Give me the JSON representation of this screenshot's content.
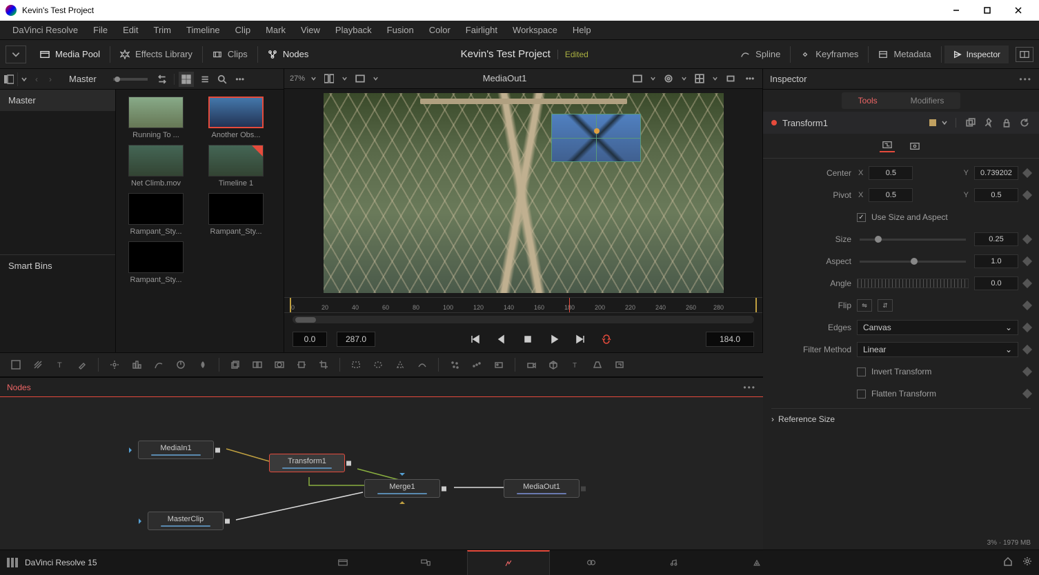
{
  "window": {
    "title": "Kevin's Test Project"
  },
  "menu": [
    "DaVinci Resolve",
    "File",
    "Edit",
    "Trim",
    "Timeline",
    "Clip",
    "Mark",
    "View",
    "Playback",
    "Fusion",
    "Color",
    "Fairlight",
    "Workspace",
    "Help"
  ],
  "uibar": {
    "media_pool": "Media Pool",
    "effects": "Effects Library",
    "clips": "Clips",
    "nodes": "Nodes",
    "project": "Kevin's Test Project",
    "edited": "Edited",
    "spline": "Spline",
    "keyframes": "Keyframes",
    "metadata": "Metadata",
    "inspector": "Inspector"
  },
  "mediapool": {
    "master": "Master",
    "tree_master": "Master",
    "smart_bins": "Smart Bins",
    "thumbs": [
      {
        "label": "Running To ..."
      },
      {
        "label": "Another Obs..."
      },
      {
        "label": "Net Climb.mov"
      },
      {
        "label": "Timeline 1"
      },
      {
        "label": "Rampant_Sty..."
      },
      {
        "label": "Rampant_Sty..."
      },
      {
        "label": "Rampant_Sty..."
      }
    ]
  },
  "viewer": {
    "zoom": "27%",
    "title": "MediaOut1",
    "ruler": [
      "0",
      "20",
      "40",
      "60",
      "80",
      "100",
      "120",
      "140",
      "160",
      "180",
      "200",
      "220",
      "240",
      "260",
      "280"
    ],
    "in_frame": "0.0",
    "out_frame": "287.0",
    "current": "184.0"
  },
  "nodes_panel": {
    "title": "Nodes",
    "nodes": {
      "mediain1": "MediaIn1",
      "transform1": "Transform1",
      "merge1": "Merge1",
      "mediaout1": "MediaOut1",
      "masterclip": "MasterClip"
    }
  },
  "inspector": {
    "title": "Inspector",
    "tabs": {
      "tools": "Tools",
      "modifiers": "Modifiers"
    },
    "node_name": "Transform1",
    "params": {
      "center_label": "Center",
      "center_x": "0.5",
      "center_y": "0.739202",
      "pivot_label": "Pivot",
      "pivot_x": "0.5",
      "pivot_y": "0.5",
      "use_size": "Use Size and Aspect",
      "size_label": "Size",
      "size": "0.25",
      "aspect_label": "Aspect",
      "aspect": "1.0",
      "angle_label": "Angle",
      "angle": "0.0",
      "flip_label": "Flip",
      "edges_label": "Edges",
      "edges": "Canvas",
      "filter_label": "Filter Method",
      "filter": "Linear",
      "invert": "Invert Transform",
      "flatten": "Flatten Transform",
      "refsize": "Reference Size"
    }
  },
  "status": {
    "mem": "3% · 1979 MB"
  },
  "footer": {
    "brand": "DaVinci Resolve 15"
  }
}
